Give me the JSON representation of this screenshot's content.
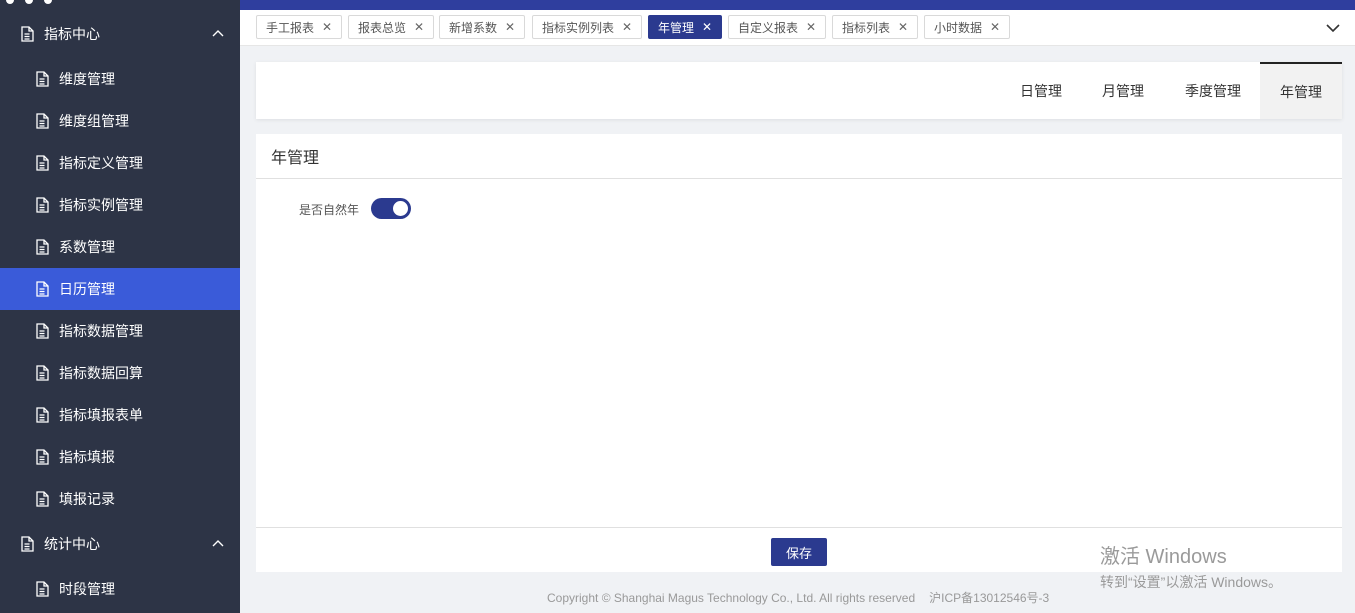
{
  "sidebar": {
    "groups": [
      {
        "label": "指标中心",
        "items": [
          {
            "label": "维度管理"
          },
          {
            "label": "维度组管理"
          },
          {
            "label": "指标定义管理"
          },
          {
            "label": "指标实例管理"
          },
          {
            "label": "系数管理"
          },
          {
            "label": "日历管理",
            "active": true
          },
          {
            "label": "指标数据管理"
          },
          {
            "label": "指标数据回算"
          },
          {
            "label": "指标填报表单"
          },
          {
            "label": "指标填报"
          },
          {
            "label": "填报记录"
          }
        ]
      },
      {
        "label": "统计中心",
        "items": [
          {
            "label": "时段管理"
          }
        ]
      }
    ]
  },
  "tabs": [
    {
      "label": "手工报表"
    },
    {
      "label": "报表总览"
    },
    {
      "label": "新增系数"
    },
    {
      "label": "指标实例列表"
    },
    {
      "label": "年管理",
      "active": true
    },
    {
      "label": "自定义报表"
    },
    {
      "label": "指标列表"
    },
    {
      "label": "小时数据"
    }
  ],
  "subtabs": [
    {
      "label": "日管理"
    },
    {
      "label": "月管理"
    },
    {
      "label": "季度管理"
    },
    {
      "label": "年管理",
      "active": true
    }
  ],
  "panel": {
    "title": "年管理",
    "field_label": "是否自然年",
    "natural_year_enabled": true,
    "save_label": "保存"
  },
  "footer": {
    "copyright": "Copyright © Shanghai Magus Technology Co., Ltd. All rights reserved",
    "icp": "沪ICP备13012546号-3"
  },
  "watermark": {
    "line1": "激活 Windows",
    "line2": "转到“设置”以激活 Windows。"
  },
  "colors": {
    "sidebar_bg": "#2d3446",
    "sidebar_active": "#3a5bd9",
    "primary": "#2b3a8f"
  },
  "icons": {
    "menu_item": "document-icon",
    "group_toggle": "chevron-up-icon",
    "tab_close": "close-icon",
    "tab_overflow": "chevron-down-icon"
  }
}
